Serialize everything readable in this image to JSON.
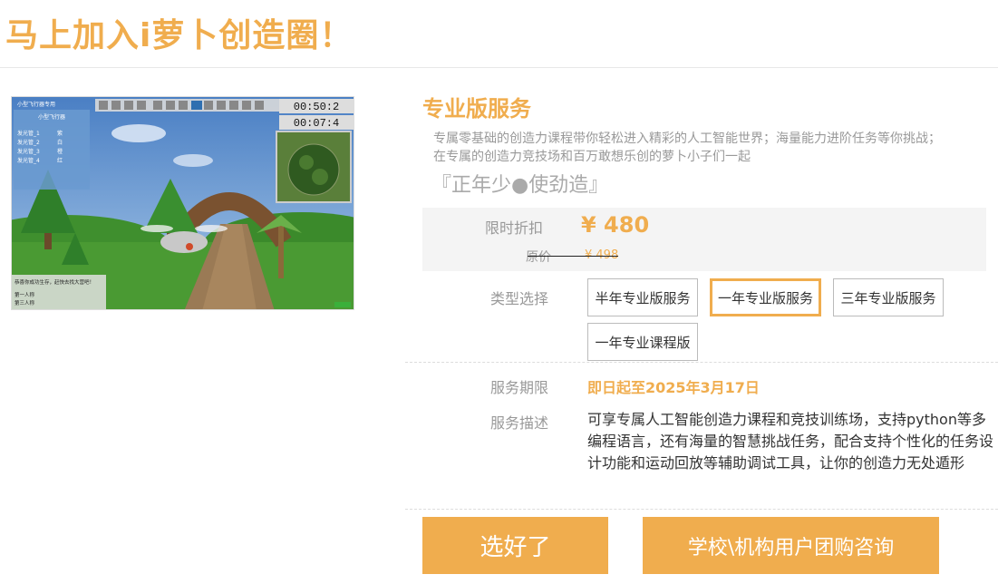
{
  "header": {
    "headline": "马上加入i萝卜创造圈！"
  },
  "preview": {
    "image_name": "game-screenshot",
    "hud_timer_1": "00:50:2",
    "hud_timer_2": "00:07:4",
    "panel_title": "小型飞行器",
    "dialog_text": "恭喜你成功生存，赶快去找大营吧！",
    "items": [
      "发光管_1",
      "发光管_2",
      "发光管_3",
      "发光管_4"
    ],
    "values": [
      "紫",
      "白",
      "橙",
      "红"
    ],
    "footer_lines": [
      "第一人称",
      "第三人称"
    ]
  },
  "product": {
    "title": "专业版服务",
    "desc_line1": "专属零基础的创造力课程带你轻松进入精彩的人工智能世界；海量能力进阶任务等你挑战；",
    "desc_line2": "在专属的创造力竞技场和百万敢想乐创的萝卜小子们一起",
    "slogan": "『正年少●使劲造』",
    "discount_label": "限时折扣",
    "discount_price": "¥ 480",
    "original_label": "原价",
    "original_price": "¥ 498",
    "type_label": "类型选择",
    "options": [
      "半年专业版服务",
      "一年专业版服务",
      "三年专业版服务",
      "一年专业课程版"
    ],
    "selected_option": "一年专业版服务",
    "term_label": "服务期限",
    "term_value": "即日起至2025年3月17日",
    "service_label": "服务描述",
    "service_value": "可享专属人工智能创造力课程和竞技训练场，支持python等多编程语言，还有海量的智慧挑战任务，配合支持个性化的任务设计功能和运动回放等辅助调试工具，让你的创造力无处遁形"
  },
  "actions": {
    "primary": "选好了",
    "secondary": "学校\\机构用户团购咨询"
  },
  "colors": {
    "accent": "#f0ad4e"
  }
}
